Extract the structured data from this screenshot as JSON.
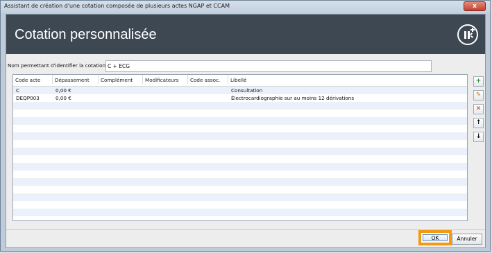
{
  "window": {
    "title": "Assistant de création d'une cotation composée de plusieurs actes NGAP et CCAM",
    "close_label": "x"
  },
  "banner": {
    "title": "Cotation personnalisée",
    "logo_icon": "ik-logo-icon"
  },
  "form": {
    "name_label": "Nom permettant d'identifier la cotation :",
    "name_value": "C + ECG"
  },
  "grid": {
    "columns": [
      "Code acte",
      "Dépassement",
      "Complément",
      "Modificateurs",
      "Code assoc.",
      "Libellé"
    ],
    "rows": [
      {
        "code": "C",
        "depassement": "0,00 €",
        "complement": "",
        "modificateurs": "",
        "code_assoc": "",
        "libelle": "Consultation"
      },
      {
        "code": "DEQP003",
        "depassement": "0,00 €",
        "complement": "",
        "modificateurs": "",
        "code_assoc": "",
        "libelle": "Électrocardiographie sur au moins 12 dérivations"
      }
    ],
    "alt_row_color": "#eaf1fb"
  },
  "tools": {
    "add_icon": "add-icon",
    "edit_icon": "edit-icon",
    "delete_icon": "delete-icon",
    "up_icon": "arrow-up-icon",
    "down_icon": "arrow-down-icon"
  },
  "buttons": {
    "ok_label": "OK",
    "cancel_label": "Annuler",
    "highlight_color": "#f39a14"
  }
}
